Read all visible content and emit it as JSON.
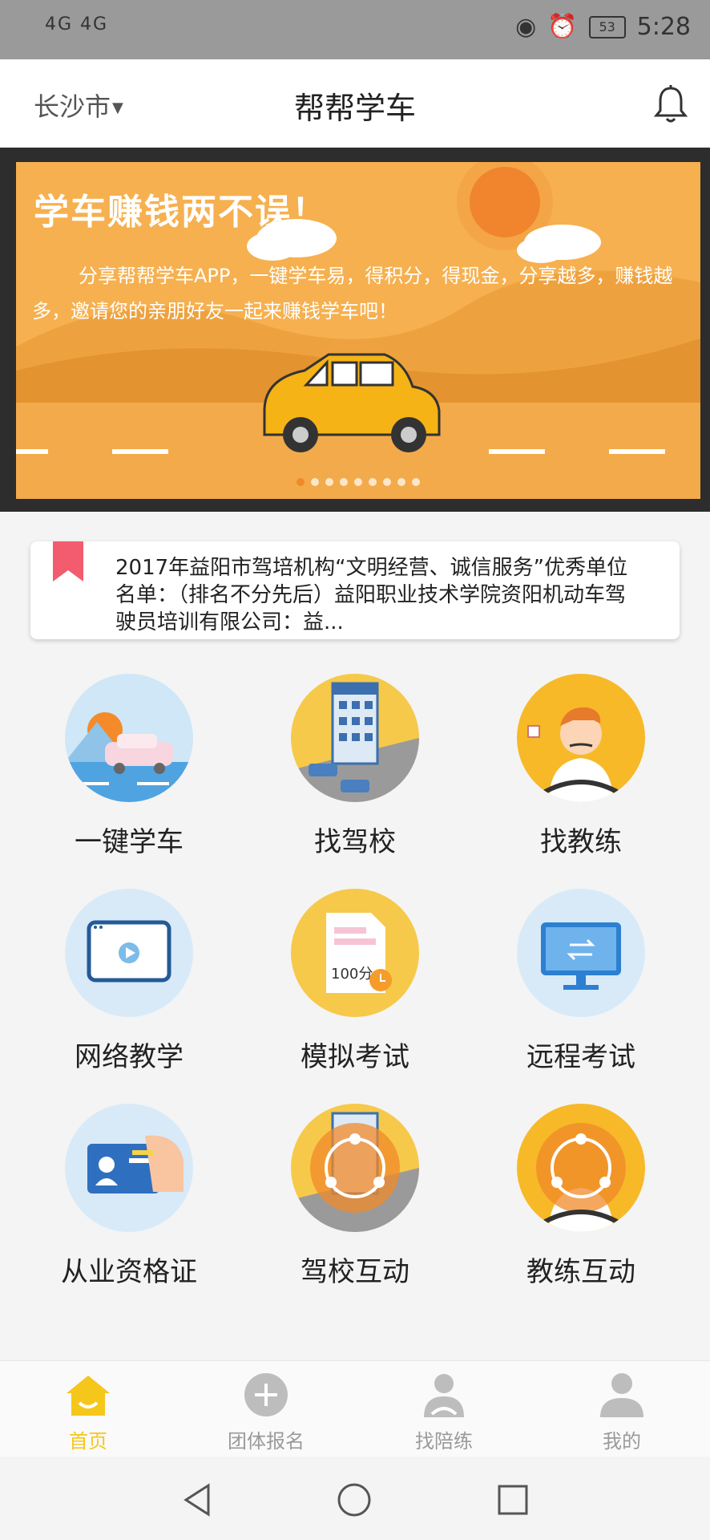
{
  "status": {
    "signal": "4G 4G",
    "time": "5:28",
    "battery": "53"
  },
  "header": {
    "city": "长沙市",
    "title": "帮帮学车"
  },
  "banner": {
    "headline": "学车赚钱两不误！",
    "subtext": "分享帮帮学车APP，一键学车易，得积分，得现金，分享越多，赚钱越多，邀请您的亲朋好友一起来赚钱学车吧！",
    "dot_count": 9,
    "active_dot": 0
  },
  "notice": {
    "text": "2017年益阳市驾培机构“文明经营、诚信服务”优秀单位名单：（排名不分先后）益阳职业技术学院资阳机动车驾驶员培训有限公司：益..."
  },
  "features": [
    {
      "label": "一键学车",
      "icon": "car-landscape-icon"
    },
    {
      "label": "找驾校",
      "icon": "school-building-icon"
    },
    {
      "label": "找教练",
      "icon": "coach-icon"
    },
    {
      "label": "网络教学",
      "icon": "video-player-icon"
    },
    {
      "label": "模拟考试",
      "icon": "exam-paper-icon"
    },
    {
      "label": "远程考试",
      "icon": "monitor-icon"
    },
    {
      "label": "从业资格证",
      "icon": "id-card-icon"
    },
    {
      "label": "驾校互动",
      "icon": "school-share-icon"
    },
    {
      "label": "教练互动",
      "icon": "coach-share-icon"
    }
  ],
  "tabs": [
    {
      "label": "首页",
      "icon": "home-icon",
      "active": true
    },
    {
      "label": "团体报名",
      "icon": "plus-circle-icon",
      "active": false
    },
    {
      "label": "找陪练",
      "icon": "driver-icon",
      "active": false
    },
    {
      "label": "我的",
      "icon": "person-icon",
      "active": false
    }
  ],
  "colors": {
    "accent": "#f5c71a",
    "banner": "#f6b04f",
    "bookmark": "#f25c6e"
  }
}
